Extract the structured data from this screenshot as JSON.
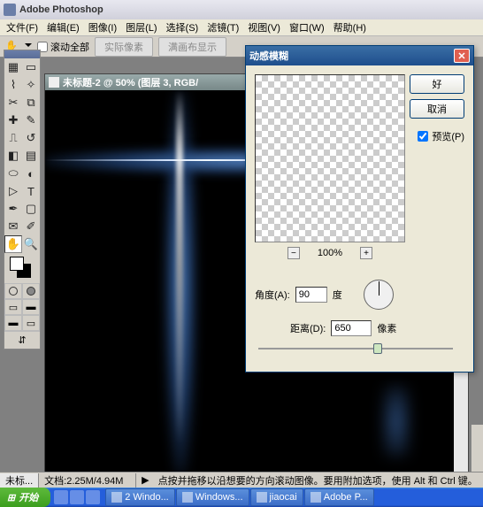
{
  "app_title": "Adobe Photoshop",
  "menu": [
    "文件(F)",
    "编辑(E)",
    "图像(I)",
    "图层(L)",
    "选择(S)",
    "滤镜(T)",
    "视图(V)",
    "窗口(W)",
    "帮助(H)"
  ],
  "options": {
    "scroll_all": "滚动全部",
    "actual_pixels": "实际像素",
    "fit_screen": "满画布显示"
  },
  "document": {
    "title": "未标题-2 @ 50% (图层 3, RGB/"
  },
  "dialog": {
    "title": "动感模糊",
    "ok": "好",
    "cancel": "取消",
    "preview_label": "预览(P)",
    "zoom": "100%",
    "angle_label": "角度(A):",
    "angle_value": "90",
    "angle_unit": "度",
    "distance_label": "距离(D):",
    "distance_value": "650",
    "distance_unit": "像素"
  },
  "status": {
    "tab": "未标...",
    "docsize": "文档:2.25M/4.94M",
    "hint": "点按并拖移以沿想要的方向滚动图像。要用附加选项，使用 Alt 和 Ctrl 键。"
  },
  "taskbar": {
    "start": "开始",
    "tasks": [
      "2 Windo...",
      "Windows...",
      "jiaocai",
      "Adobe P..."
    ]
  }
}
